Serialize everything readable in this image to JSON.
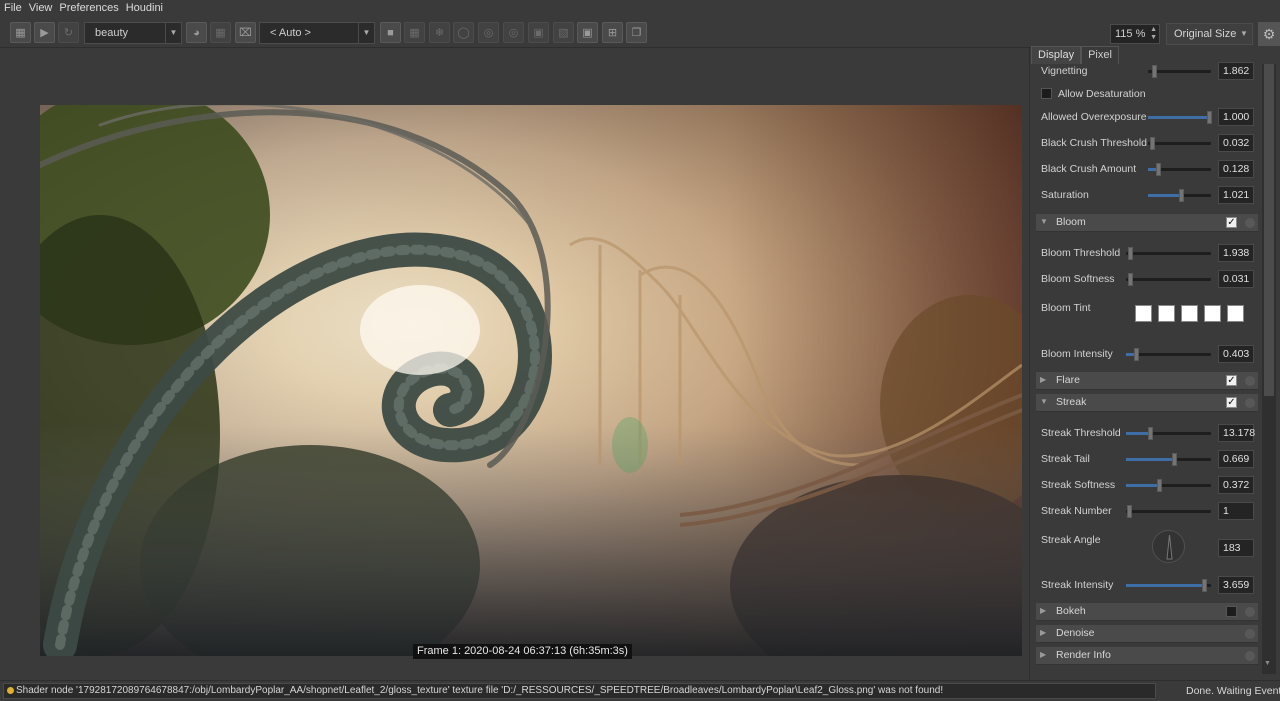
{
  "menu": [
    "File",
    "View",
    "Preferences",
    "Houdini"
  ],
  "toolbar": {
    "aov_value": "beauty",
    "camera_value": "< Auto >",
    "zoom_value": "115 %",
    "size_mode": "Original Size"
  },
  "frame_info": "Frame 1: 2020-08-24 06:37:13 (6h:35m:3s)",
  "panel": {
    "tabs": [
      "Display",
      "Pixel"
    ],
    "params": {
      "vignetting": {
        "label": "Vignetting",
        "value": "1.862"
      },
      "allow_desaturation": {
        "label": "Allow Desaturation"
      },
      "allowed_overexposure": {
        "label": "Allowed Overexposure",
        "value": "1.000"
      },
      "black_crush_threshold": {
        "label": "Black Crush Threshold",
        "value": "0.032"
      },
      "black_crush_amount": {
        "label": "Black Crush Amount",
        "value": "0.128"
      },
      "saturation": {
        "label": "Saturation",
        "value": "1.021"
      },
      "bloom_threshold": {
        "label": "Bloom Threshold",
        "value": "1.938"
      },
      "bloom_softness": {
        "label": "Bloom Softness",
        "value": "0.031"
      },
      "bloom_tint": {
        "label": "Bloom Tint"
      },
      "bloom_intensity": {
        "label": "Bloom Intensity",
        "value": "0.403"
      },
      "streak_threshold": {
        "label": "Streak Threshold",
        "value": "13.178"
      },
      "streak_tail": {
        "label": "Streak Tail",
        "value": "0.669"
      },
      "streak_softness": {
        "label": "Streak Softness",
        "value": "0.372"
      },
      "streak_number": {
        "label": "Streak Number",
        "value": "1"
      },
      "streak_angle": {
        "label": "Streak Angle",
        "value": "183"
      },
      "streak_intensity": {
        "label": "Streak Intensity",
        "value": "3.659"
      }
    },
    "sections": {
      "bloom": "Bloom",
      "flare": "Flare",
      "streak": "Streak",
      "bokeh": "Bokeh",
      "denoise": "Denoise",
      "render_info": "Render Info"
    }
  },
  "status": {
    "message": "Shader node '17928172089764678847:/obj/LombardyPoplar_AA/shopnet/Leaflet_2/gloss_texture' texture file 'D:/_RESSOURCES/_SPEEDTREE/Broadleaves/LombardyPoplar\\Leaf2_Gloss.png' was not found!",
    "right": "Done. Waiting Events"
  },
  "colors": {
    "accent": "#3f6ea6",
    "status_dot": "#e0b030"
  }
}
